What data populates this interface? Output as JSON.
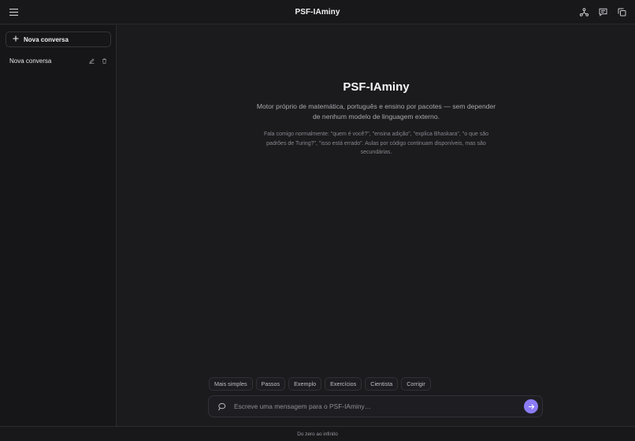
{
  "header": {
    "title": "PSF-IAminy",
    "icons": [
      "menu-icon",
      "network-icon",
      "chat-icon",
      "copy-icon"
    ]
  },
  "sidebar": {
    "new_chat_label": "Nova conversa",
    "conversations": [
      {
        "label": "Nova conversa"
      }
    ]
  },
  "main": {
    "title": "PSF-IAminy",
    "subtitle": "Motor próprio de matemática, português e ensino por pacotes — sem depender de nenhum modelo de linguagem externo.",
    "note": "Fala comigo normalmente: \"quem é você?\", \"ensina adição\", \"explica Bhaskara\", \"o que são padrões de Turing?\", \"isso está errado\". Aulas por código continuam disponíveis, mas são secundárias."
  },
  "chips": [
    "Mais simples",
    "Passos",
    "Exemplo",
    "Exercícios",
    "Cientista",
    "Corrigir"
  ],
  "composer": {
    "placeholder": "Escreve uma mensagem para o PSF-IAminy…",
    "value": ""
  },
  "footer": {
    "text": "Do zero ao infinito"
  },
  "colors": {
    "accent": "#8b7cf6",
    "background": "#1b1b1e",
    "sidebar": "#161618"
  }
}
